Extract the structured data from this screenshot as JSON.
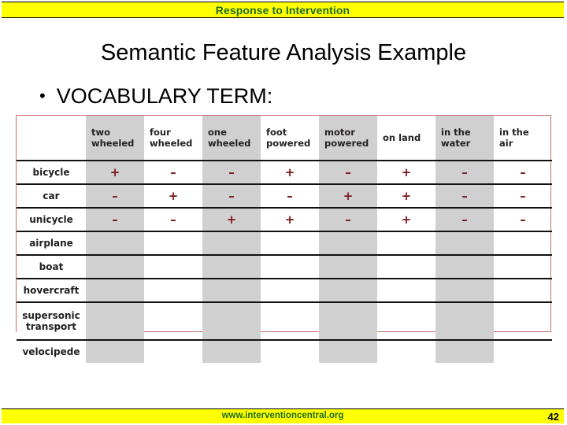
{
  "banner": {
    "title": "Response to Intervention",
    "text_color": "#1f6b1f",
    "background_color": "#ffff00"
  },
  "slide": {
    "title": "Semantic Feature Analysis Example",
    "bullet_marker": "•",
    "bullet_text": "VOCABULARY TERM:"
  },
  "table": {
    "row_label_header": "",
    "columns": [
      "two wheeled",
      "four wheeled",
      "one wheeled",
      "foot powered",
      "motor powered",
      "on land",
      "in the water",
      "in the air"
    ],
    "column_lines": [
      [
        "two",
        "wheeled"
      ],
      [
        "four",
        "wheeled"
      ],
      [
        "one",
        "wheeled"
      ],
      [
        "foot",
        "powered"
      ],
      [
        "motor",
        "powered"
      ],
      [
        "on land",
        ""
      ],
      [
        "in the",
        "water"
      ],
      [
        "in the",
        "air"
      ]
    ],
    "shaded_columns": [
      0,
      2,
      4,
      6
    ],
    "border_color": "#c4706c",
    "shade_color": "#d0d0d0",
    "mark_color": "#7b1418",
    "rows": [
      {
        "label": "bicycle",
        "label_lines": [
          "bicycle"
        ],
        "values": [
          "+",
          "–",
          "–",
          "+",
          "–",
          "+",
          "–",
          "–"
        ]
      },
      {
        "label": "car",
        "label_lines": [
          "car"
        ],
        "values": [
          "–",
          "+",
          "–",
          "–",
          "+",
          "+",
          "–",
          "–"
        ]
      },
      {
        "label": "unicycle",
        "label_lines": [
          "unicycle"
        ],
        "values": [
          "–",
          "–",
          "+",
          "+",
          "–",
          "+",
          "–",
          "–"
        ]
      },
      {
        "label": "airplane",
        "label_lines": [
          "airplane"
        ],
        "values": [
          "",
          "",
          "",
          "",
          "",
          "",
          "",
          ""
        ]
      },
      {
        "label": "boat",
        "label_lines": [
          "boat"
        ],
        "values": [
          "",
          "",
          "",
          "",
          "",
          "",
          "",
          ""
        ]
      },
      {
        "label": "hovercraft",
        "label_lines": [
          "hovercraft"
        ],
        "values": [
          "",
          "",
          "",
          "",
          "",
          "",
          "",
          ""
        ]
      },
      {
        "label": "supersonic transport",
        "label_lines": [
          "supersonic",
          "transport"
        ],
        "values": [
          "",
          "",
          "",
          "",
          "",
          "",
          "",
          ""
        ]
      },
      {
        "label": "velocipede",
        "label_lines": [
          "velocipede"
        ],
        "values": [
          "",
          "",
          "",
          "",
          "",
          "",
          "",
          ""
        ]
      }
    ]
  },
  "footer": {
    "url": "www.interventioncentral.org",
    "page_number": "42",
    "background_color": "#ffff00",
    "url_color": "#1f6b1f"
  }
}
